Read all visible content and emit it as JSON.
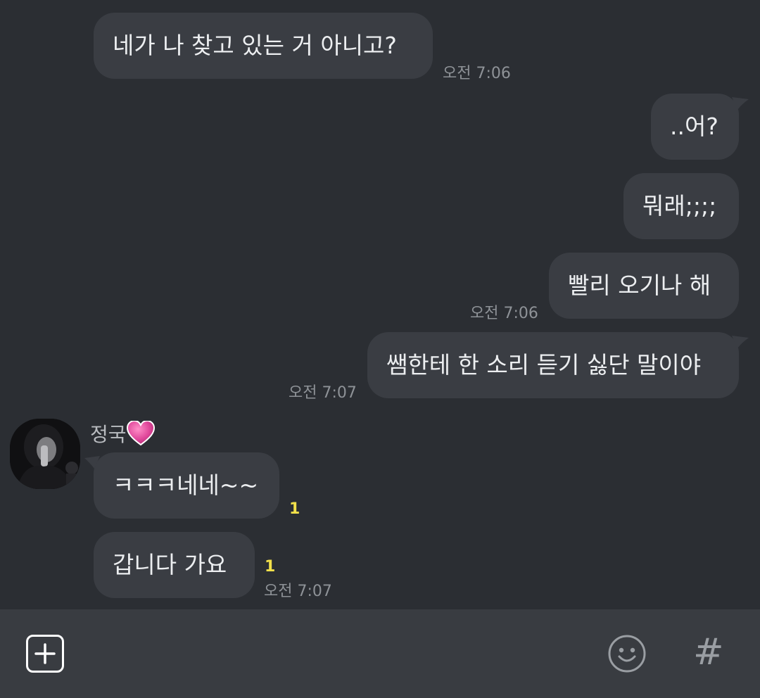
{
  "messages": [
    {
      "text": "네가 나 찾고 있는 거 아니고?",
      "time": "오전 7:06"
    },
    {
      "text": "..어?"
    },
    {
      "text": "뭐래;;;;"
    },
    {
      "text": "빨리 오기나 해",
      "time": "오전 7:06"
    },
    {
      "text": "쌤한테 한 소리 듣기 싫단 말이야",
      "time": "오전 7:07"
    },
    {
      "text": "ㅋㅋㅋ네네~~",
      "unread": "1"
    },
    {
      "text": "갑니다 가요",
      "unread": "1",
      "time": "오전 7:07"
    }
  ],
  "sender": {
    "name": "정국",
    "emoji": "heart-icon"
  },
  "footer": {
    "icons": [
      "plus-icon",
      "emoticon-icon",
      "hashtag-icon"
    ],
    "hash_glyph": "#"
  },
  "colors": {
    "background": "#2b2e33",
    "bubble": "#3a3d43",
    "unread": "#f2e04a",
    "footer": "#393c41"
  }
}
